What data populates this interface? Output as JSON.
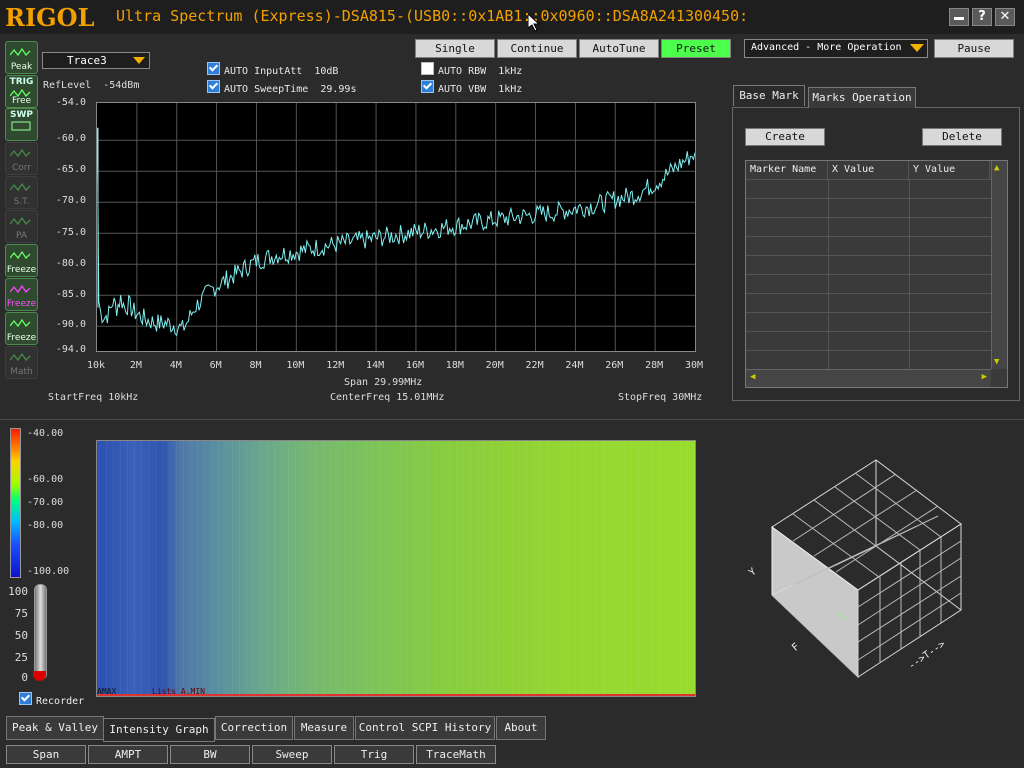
{
  "titlebar": {
    "logo": "RIGOL",
    "title": "Ultra Spectrum (Express)-DSA815-(USB0::0x1AB1::0x0960::DSA8A241300450:",
    "minimize_icon": "minimize-icon",
    "help_label": "?",
    "close_icon": "close-icon"
  },
  "sidebar": {
    "items": [
      {
        "top": "",
        "label": "Peak",
        "icon": "peak-icon"
      },
      {
        "top": "TRIG",
        "label": "Free",
        "icon": "trigger-icon"
      },
      {
        "top": "SWP",
        "label": "",
        "icon": "sweep-icon"
      },
      {
        "top": "",
        "label": "Corr",
        "icon": "correction-icon"
      },
      {
        "top": "",
        "label": "S.T.",
        "icon": "spectrum-trace-icon"
      },
      {
        "top": "",
        "label": "PA",
        "icon": "preamp-icon"
      },
      {
        "top": "",
        "label": "Freeze",
        "icon": "freeze-trace-icon"
      },
      {
        "top": "",
        "label": "Freeze",
        "icon": "freeze-trace-icon"
      },
      {
        "top": "",
        "label": "Freeze",
        "icon": "freeze-trace-icon"
      },
      {
        "top": "",
        "label": "Math",
        "icon": "math-icon"
      }
    ]
  },
  "trace_select": {
    "value": "Trace3"
  },
  "reflevel": {
    "label": "RefLevel",
    "value": "-54dBm"
  },
  "toolbar": {
    "single": "Single",
    "continue": "Continue",
    "autotune": "AutoTune",
    "preset": "Preset",
    "advanced": "Advanced - More Operation",
    "pause": "Pause"
  },
  "settings": {
    "auto_inputatt": {
      "label": "AUTO InputAtt",
      "value": "10dB",
      "checked": true
    },
    "auto_sweeptime": {
      "label": "AUTO SweepTime",
      "value": "29.99s",
      "checked": true
    },
    "auto_rbw": {
      "label": "AUTO RBW",
      "value": "1kHz",
      "checked": false
    },
    "auto_vbw": {
      "label": "AUTO VBW",
      "value": "1kHz",
      "checked": true
    }
  },
  "chart_data": {
    "type": "line",
    "title": "",
    "xlabel": "",
    "ylabel": "",
    "y_tick_labels": [
      "-54.0",
      "-60.0",
      "-65.0",
      "-70.0",
      "-75.0",
      "-80.0",
      "-85.0",
      "-90.0",
      "-94.0"
    ],
    "x_tick_labels": [
      "10k",
      "2M",
      "4M",
      "6M",
      "8M",
      "10M",
      "12M",
      "14M",
      "16M",
      "18M",
      "20M",
      "22M",
      "24M",
      "26M",
      "28M",
      "30M"
    ],
    "ylim": [
      -94,
      -54
    ],
    "xlim_mhz": [
      0.01,
      30
    ],
    "grid": true,
    "line_color": "#7ff0f0",
    "series": [
      {
        "x_mhz": [
          0.01,
          0.05,
          0.1,
          0.2,
          0.4,
          0.6,
          0.8,
          1.0,
          1.2,
          1.4,
          1.6,
          1.8,
          2.0,
          2.5,
          3.0,
          3.5,
          4.0,
          4.3,
          4.6,
          4.9,
          5.2,
          5.6,
          6.0,
          6.5,
          7.0,
          7.5,
          8.0,
          9.0,
          10.0,
          11.0,
          12.0,
          13.0,
          14.0,
          15.0,
          16.0,
          17.0,
          18.0,
          19.0,
          20.0,
          21.0,
          22.0,
          23.0,
          24.0,
          25.0,
          26.0,
          27.0,
          28.0,
          29.0,
          30.0
        ],
        "values": [
          -58,
          -67,
          -86,
          -88,
          -88.5,
          -88,
          -86,
          -87,
          -85.5,
          -87,
          -86.5,
          -87.5,
          -88,
          -89,
          -89.5,
          -89.5,
          -90,
          -90.5,
          -89,
          -87,
          -86,
          -84.5,
          -83.5,
          -82.5,
          -81.5,
          -80.5,
          -79.5,
          -78.5,
          -78,
          -77.3,
          -76.8,
          -76.3,
          -75.8,
          -75.3,
          -74.8,
          -74.3,
          -73.8,
          -73.3,
          -72.8,
          -72.4,
          -72.0,
          -71.6,
          -71.0,
          -70.5,
          -69.5,
          -68.8,
          -67.0,
          -64.5,
          -62.0
        ]
      }
    ]
  },
  "sweep_info": {
    "start": "StartFreq  10kHz",
    "span": "Span  29.99MHz",
    "center": "CenterFreq  15.01MHz",
    "stop": "StopFreq  30MHz"
  },
  "marker_panel": {
    "tabs": [
      "Base Mark",
      "Marks Operation"
    ],
    "create": "Create",
    "delete": "Delete",
    "columns": [
      "Marker Name",
      "X Value",
      "Y Value"
    ],
    "scroll_up": "▲",
    "scroll_down": "▼",
    "scroll_left": "◀",
    "scroll_right": "▶"
  },
  "intensity": {
    "scale_labels": [
      "-40.00",
      "-60.00",
      "-70.00",
      "-80.00",
      "-100.00"
    ],
    "slider_labels": [
      "100",
      "75",
      "50",
      "25",
      "0"
    ],
    "recorder_label": "Recorder",
    "recorder_checked": true,
    "overlay_text": "AMAX",
    "overlay_text2": "Lists A.MIN"
  },
  "cube": {
    "axis_y": "Y",
    "axis_f": "F",
    "axis_t": "-->T-->"
  },
  "bottom_tabs": [
    "Peak & Valley",
    "Intensity Graph",
    "Correction",
    "Measure",
    "Control SCPI History",
    "About"
  ],
  "function_buttons": [
    "Span",
    "AMPT",
    "BW",
    "Sweep",
    "Trig",
    "TraceMath"
  ]
}
